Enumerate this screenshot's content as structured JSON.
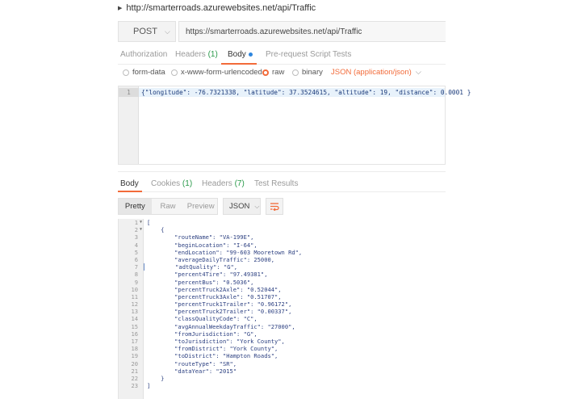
{
  "request": {
    "title": "http://smarterroads.azurewebsites.net/api/Traffic",
    "method": "POST",
    "url": "https://smarterroads.azurewebsites.net/api/Traffic"
  },
  "request_tabs": [
    {
      "label": "Authorization"
    },
    {
      "label": "Headers",
      "count": "(1)"
    },
    {
      "label": "Body",
      "active": true
    },
    {
      "label": "Pre-request Script"
    },
    {
      "label": "Tests"
    }
  ],
  "body_options": {
    "form_data": "form-data",
    "urlencoded": "x-www-form-urlencoded",
    "raw": "raw",
    "binary": "binary",
    "content_type": "JSON (application/json)",
    "selected": "raw"
  },
  "request_body": {
    "line_number": "1",
    "code": "{\"longitude\": -76.7321338, \"latitude\": 37.3524615, \"altitude\": 19, \"distance\": 0.0001 }"
  },
  "response_tabs": [
    {
      "label": "Body",
      "active": true
    },
    {
      "label": "Cookies",
      "count": "(1)"
    },
    {
      "label": "Headers",
      "count": "(7)"
    },
    {
      "label": "Test Results"
    }
  ],
  "response_toolbar": {
    "views": [
      "Pretty",
      "Raw",
      "Preview"
    ],
    "active_view": "Pretty",
    "format": "JSON",
    "wrap_icon": "wrap-lines-icon"
  },
  "response_body": [
    {
      "n": "1",
      "fold": true,
      "code": "["
    },
    {
      "n": "2",
      "fold": true,
      "code": "    {"
    },
    {
      "n": "3",
      "code": "        \"routeName\": \"VA-199E\","
    },
    {
      "n": "4",
      "code": "        \"beginLocation\": \"I-64\","
    },
    {
      "n": "5",
      "code": "        \"endLocation\": \"99-603 Mooretown Rd\","
    },
    {
      "n": "6",
      "code": "        \"averageDailyTraffic\": 25000,"
    },
    {
      "n": "7",
      "code": "        \"adtQuality\": \"G\",",
      "cursor": true
    },
    {
      "n": "8",
      "code": "        \"percent4Tire\": \"97.49381\","
    },
    {
      "n": "9",
      "code": "        \"percentBus\": \"0.5036\","
    },
    {
      "n": "10",
      "code": "        \"percentTruck2Axle\": \"0.52044\","
    },
    {
      "n": "11",
      "code": "        \"percentTruck3Axle\": \"0.51707\","
    },
    {
      "n": "12",
      "code": "        \"percentTruck1Trailer\": \"0.96172\","
    },
    {
      "n": "13",
      "code": "        \"percentTruck2Trailer\": \"0.00337\","
    },
    {
      "n": "14",
      "code": "        \"classQualityCode\": \"C\","
    },
    {
      "n": "15",
      "code": "        \"avgAnnualWeekdayTraffic\": \"27000\","
    },
    {
      "n": "16",
      "code": "        \"fromJurisdiction\": \"G\","
    },
    {
      "n": "17",
      "code": "        \"toJurisdiction\": \"York County\","
    },
    {
      "n": "18",
      "code": "        \"fromDistrict\": \"York County\","
    },
    {
      "n": "19",
      "code": "        \"toDistrict\": \"Hampton Roads\","
    },
    {
      "n": "20",
      "code": "        \"routeType\": \"SR\","
    },
    {
      "n": "21",
      "code": "        \"dataYear\": \"2015\""
    },
    {
      "n": "22",
      "code": "    }"
    },
    {
      "n": "23",
      "code": "]"
    }
  ],
  "colors": {
    "accent": "#f26b3a",
    "count_green": "#2a9a4a",
    "code_blue": "#2b3f80",
    "dot_blue": "#2e86de"
  }
}
